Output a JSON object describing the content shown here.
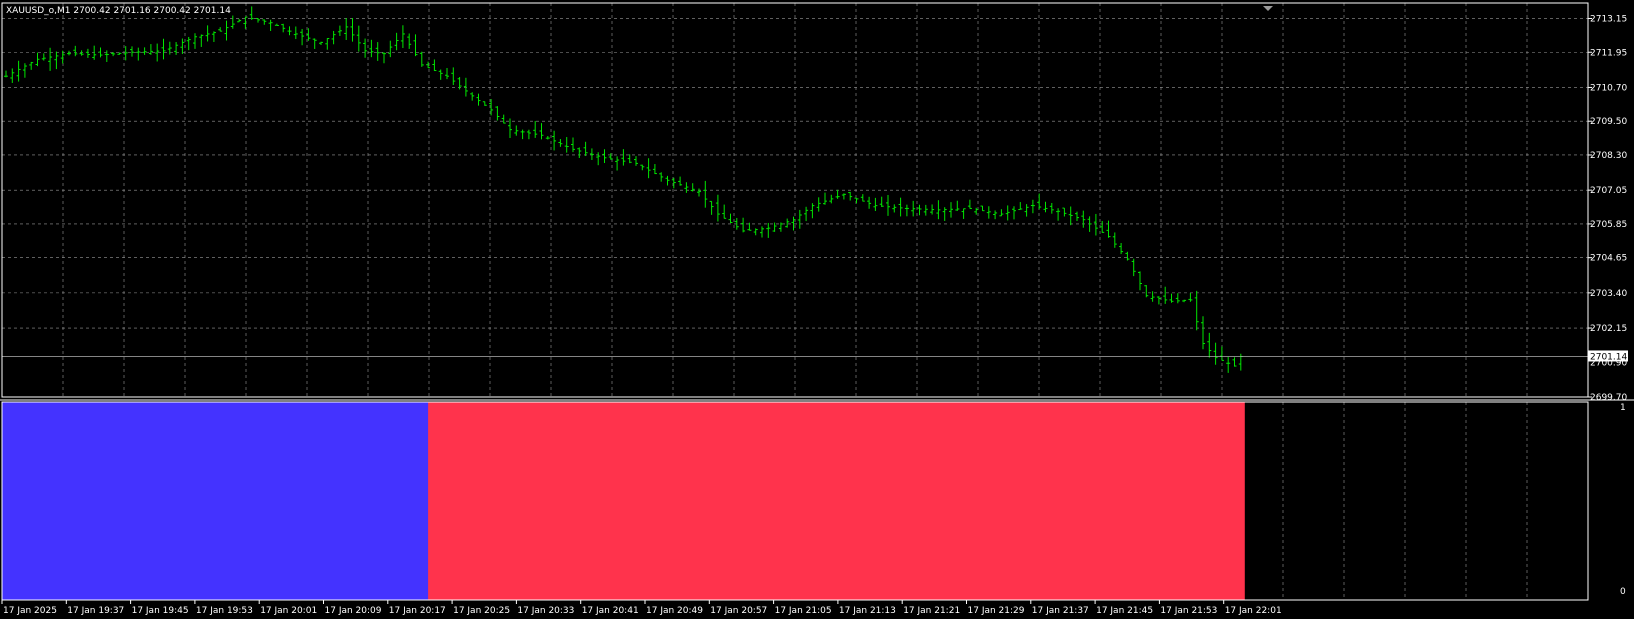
{
  "window": {
    "symbol_info": "XAUUSD_o,M1  2700.42 2701.16 2700.42 2701.14",
    "current_price_label": "2701.14",
    "partial_label": "2700.90"
  },
  "colors": {
    "background": "#000000",
    "grid": "#9a9a9a",
    "bar_color": "#00e600",
    "indicator_bullish": "#4433ff",
    "indicator_bearish": "#ff334c",
    "text": "#ffffff",
    "current_price_line": "#b0b0b0"
  },
  "chart_data": [
    {
      "type": "ohlc",
      "name": "price",
      "grid": true,
      "y_ticks": [
        "2713.15",
        "2711.95",
        "2710.70",
        "2709.50",
        "2708.30",
        "2707.05",
        "2705.85",
        "2704.65",
        "2703.40",
        "2702.15",
        "2699.70"
      ],
      "ylim": [
        2699.7,
        2713.7
      ],
      "x_tick_labels": [
        "17 Jan 2025",
        "17 Jan 19:37",
        "17 Jan 19:45",
        "17 Jan 19:53",
        "17 Jan 20:01",
        "17 Jan 20:09",
        "17 Jan 20:17",
        "17 Jan 20:25",
        "17 Jan 20:33",
        "17 Jan 20:41",
        "17 Jan 20:49",
        "17 Jan 20:57",
        "17 Jan 21:05",
        "17 Jan 21:13",
        "17 Jan 21:21",
        "17 Jan 21:29",
        "17 Jan 21:37",
        "17 Jan 21:45",
        "17 Jan 21:53",
        "17 Jan 22:01"
      ],
      "close_path": [
        [
          0,
          2711.1
        ],
        [
          5,
          2711.7
        ],
        [
          10,
          2711.9
        ],
        [
          15,
          2711.85
        ],
        [
          20,
          2711.95
        ],
        [
          25,
          2712.0
        ],
        [
          30,
          2712.5
        ],
        [
          34,
          2712.7
        ],
        [
          38,
          2713.2
        ],
        [
          42,
          2713.0
        ],
        [
          46,
          2712.6
        ],
        [
          50,
          2712.3
        ],
        [
          54,
          2712.85
        ],
        [
          57,
          2712.0
        ],
        [
          60,
          2711.9
        ],
        [
          63,
          2712.6
        ],
        [
          66,
          2711.5
        ],
        [
          70,
          2711.1
        ],
        [
          74,
          2710.4
        ],
        [
          77,
          2709.9
        ],
        [
          80,
          2709.2
        ],
        [
          85,
          2709.0
        ],
        [
          90,
          2708.5
        ],
        [
          95,
          2708.2
        ],
        [
          100,
          2708.0
        ],
        [
          105,
          2707.4
        ],
        [
          110,
          2707.0
        ],
        [
          113,
          2706.2
        ],
        [
          117,
          2705.6
        ],
        [
          121,
          2705.7
        ],
        [
          125,
          2706.0
        ],
        [
          128,
          2706.5
        ],
        [
          133,
          2706.9
        ],
        [
          138,
          2706.5
        ],
        [
          143,
          2706.4
        ],
        [
          148,
          2706.35
        ],
        [
          153,
          2706.4
        ],
        [
          158,
          2706.2
        ],
        [
          163,
          2706.5
        ],
        [
          167,
          2706.3
        ],
        [
          171,
          2706.0
        ],
        [
          175,
          2705.4
        ],
        [
          178,
          2704.6
        ],
        [
          181,
          2703.3
        ],
        [
          185,
          2703.1
        ],
        [
          188,
          2703.15
        ],
        [
          190,
          2701.6
        ],
        [
          192,
          2701.1
        ],
        [
          195,
          2700.8
        ],
        [
          196,
          2701.14
        ]
      ]
    },
    {
      "type": "histogram",
      "name": "indicator",
      "y_ticks": [
        "1",
        "0"
      ],
      "ylim": [
        0,
        1
      ],
      "segments": [
        {
          "from_bar": 0,
          "to_bar": 67,
          "value": 1,
          "color_key": "indicator_bullish"
        },
        {
          "from_bar": 67,
          "to_bar": 196,
          "value": 1,
          "color_key": "indicator_bearish"
        }
      ]
    }
  ]
}
